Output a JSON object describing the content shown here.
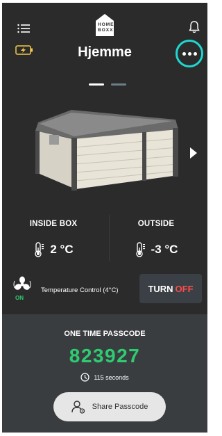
{
  "header": {
    "title": "Hjemme",
    "logo_text": "HOME BOXX",
    "menu_icon": "hamburger-menu-icon",
    "notification_icon": "bell-icon",
    "battery_icon": "battery-charging-icon",
    "more_icon": "more-horizontal-icon"
  },
  "carousel": {
    "pages": 2,
    "active_page": 1,
    "next_icon": "chevron-right-icon"
  },
  "temperatures": {
    "inside": {
      "label": "INSIDE BOX",
      "value": "2 °C",
      "icon": "thermometer-icon"
    },
    "outside": {
      "label": "OUTSIDE",
      "value": "-3 °C",
      "icon": "thermometer-icon"
    }
  },
  "control": {
    "fan_icon": "fan-icon",
    "fan_status": "ON",
    "label": "Temperature Control (4°C)",
    "button_turn": "TURN",
    "button_off": "OFF"
  },
  "passcode": {
    "title": "ONE TIME PASSCODE",
    "code": "823927",
    "timer": "115 seconds",
    "timer_icon": "clock-icon",
    "share_label": "Share Passcode",
    "share_icon": "share-user-icon"
  },
  "colors": {
    "background": "#2b2b2b",
    "panel": "#3a3d40",
    "accent_teal": "#1ed7d0",
    "code_green": "#2ecc71",
    "off_red": "#ff4b4b",
    "battery_yellow": "#f2c94c"
  }
}
